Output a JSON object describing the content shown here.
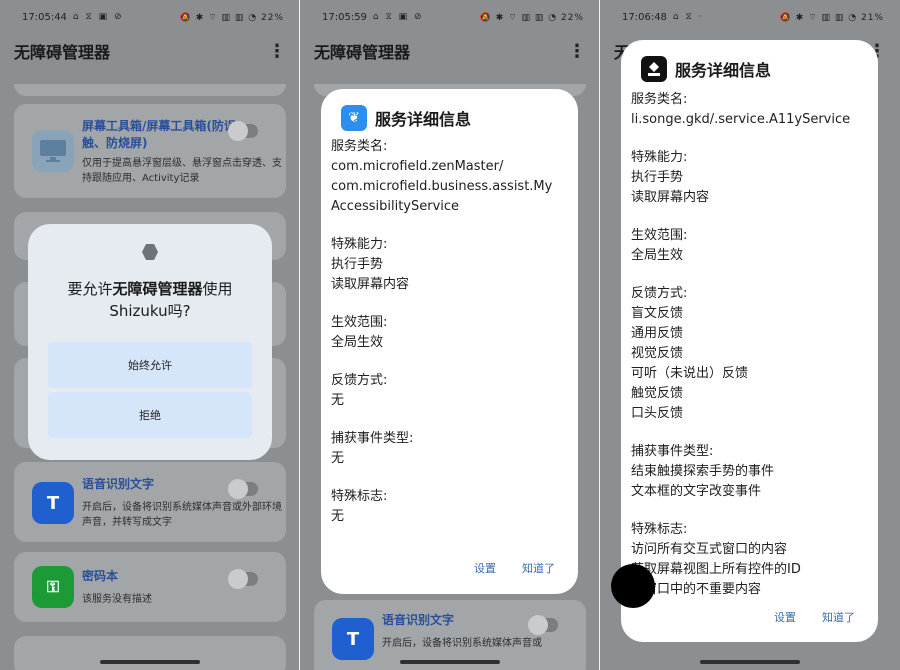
{
  "panel1": {
    "status": {
      "time": "17:05:44",
      "left_icons": "⌂ ⧖ ▣ ⊘",
      "right_icons": "🔕 ✱ ⌔ ▥ ▥ ◔",
      "battery": "22%"
    },
    "app_title": "无障碍管理器",
    "cards": [
      {
        "title": "屏幕工具箱/屏幕工具箱(防误触、防烧屏)",
        "desc": "仅用于提高悬浮窗层级、悬浮窗点击穿透、支持跟随应用、Activity记录"
      },
      {
        "title": "语音识别文字",
        "desc": "开启后，设备将识别系统媒体声音或外部环境声音，并转写成文字"
      },
      {
        "title": "密码本",
        "desc": "该服务没有描述"
      }
    ],
    "dialog": {
      "message_prefix": "要允许",
      "message_bold": "无障碍管理器",
      "message_suffix": "使用",
      "message_line2": "Shizuku吗?",
      "allow_label": "始终允许",
      "deny_label": "拒绝"
    }
  },
  "panel2": {
    "status": {
      "time": "17:05:59",
      "left_icons": "⌂ ⧖ ▣ ⊘",
      "right_icons": "🔕 ✱ ⌔ ▥ ▥ ◔",
      "battery": "22%"
    },
    "app_title": "无障碍管理器",
    "under_card": {
      "title": "语音识别文字",
      "desc": "开启后，设备将识别系统媒体声音或"
    },
    "dialog": {
      "title": "服务详细信息",
      "sections": [
        {
          "label": "服务类名:",
          "lines": [
            "com.microfield.zenMaster/",
            "com.microfield.business.assist.My",
            "AccessibilityService"
          ]
        },
        {
          "label": "特殊能力:",
          "lines": [
            "执行手势",
            "读取屏幕内容"
          ]
        },
        {
          "label": "生效范围:",
          "lines": [
            "全局生效"
          ]
        },
        {
          "label": "反馈方式:",
          "lines": [
            "无"
          ]
        },
        {
          "label": "捕获事件类型:",
          "lines": [
            "无"
          ]
        },
        {
          "label": "特殊标志:",
          "lines": [
            "无"
          ]
        }
      ],
      "settings_label": "设置",
      "ok_label": "知道了"
    }
  },
  "panel3": {
    "status": {
      "time": "17:06:48",
      "left_icons": "⌂ ⧖ ·",
      "right_icons": "🔕 ✱ ⌔ ▥ ▥ ◔",
      "battery": "21%"
    },
    "app_title": "无",
    "dialog": {
      "title": "服务详细信息",
      "sections": [
        {
          "label": "服务类名:",
          "lines": [
            "li.songe.gkd/.service.A11yService"
          ]
        },
        {
          "label": "特殊能力:",
          "lines": [
            "执行手势",
            "读取屏幕内容"
          ]
        },
        {
          "label": "生效范围:",
          "lines": [
            "全局生效"
          ]
        },
        {
          "label": "反馈方式:",
          "lines": [
            "盲文反馈",
            "通用反馈",
            "视觉反馈",
            "可听（未说出）反馈",
            "触觉反馈",
            "口头反馈"
          ]
        },
        {
          "label": "捕获事件类型:",
          "lines": [
            "结束触摸探索手势的事件",
            "文本框的文字改变事件"
          ]
        },
        {
          "label": "特殊标志:",
          "lines": [
            "访问所有交互式窗口的内容",
            "获取屏幕视图上所有控件的ID",
            "在窗口中的不重要内容"
          ]
        }
      ],
      "settings_label": "设置",
      "ok_label": "知道了"
    }
  },
  "colors": {
    "accent": "#3a6db0",
    "dialog_bg": "#ffffff",
    "scrim": "#8b8f92"
  },
  "icons": [
    "desktop-icon",
    "text-recognition-icon",
    "key-icon",
    "shizuku-icon",
    "leaf-icon",
    "gkd-icon",
    "more-vert-icon"
  ]
}
